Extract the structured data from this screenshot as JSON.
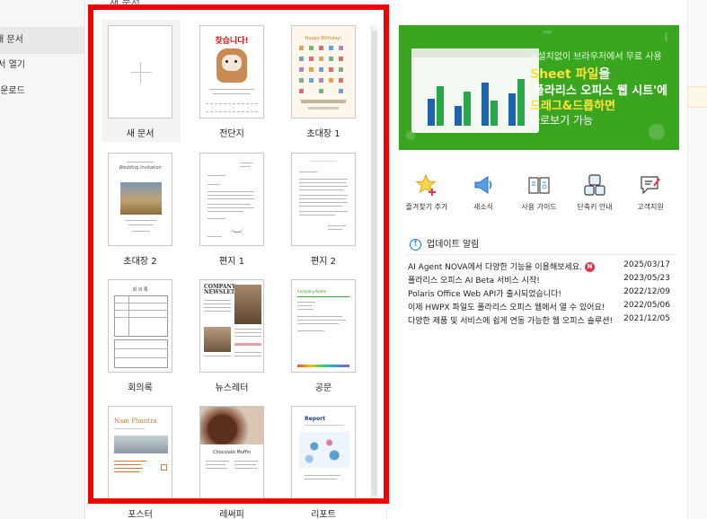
{
  "sidebar": {
    "items": [
      {
        "label": "새 문서",
        "active": true
      },
      {
        "label": "문서 열기",
        "active": false
      },
      {
        "label": "다운로드",
        "active": false
      }
    ]
  },
  "templates_section": {
    "title": "새 문서",
    "templates": [
      {
        "label": "새 문서"
      },
      {
        "label": "전단지",
        "thumb_text": "찾습니다!"
      },
      {
        "label": "초대장 1",
        "thumb_text": "Happy Birthday!"
      },
      {
        "label": "초대장 2",
        "thumb_text": "Wedding Invitation"
      },
      {
        "label": "편지 1"
      },
      {
        "label": "편지 2"
      },
      {
        "label": "회의록",
        "thumb_text": "회 의 록"
      },
      {
        "label": "뉴스레터",
        "thumb_text": "COMPANY NEWSLETTER"
      },
      {
        "label": "공문",
        "thumb_text": "Company Name"
      },
      {
        "label": "포스터",
        "thumb_text": "Nam Phuntra"
      },
      {
        "label": "레써피",
        "thumb_text": "Chocolate Muffin"
      },
      {
        "label": "리포트",
        "thumb_text": "Report"
      }
    ]
  },
  "banner": {
    "line1": "#설치없이 브라우저에서 무료 사용",
    "line2_highlight": "Sheet 파일",
    "line2_rest": "을",
    "line3": "'폴라리스 오피스 웹 시트'에",
    "line4": "드래그&드롭하면",
    "line5": "바로보기 가능",
    "bg_color": "#3aa51f",
    "accent_color": "#ffe23d"
  },
  "quick_links": [
    {
      "label": "즐겨찾기 추가",
      "icon": "star-add-icon"
    },
    {
      "label": "새소식",
      "icon": "megaphone-icon"
    },
    {
      "label": "사용 가이드",
      "icon": "book-icon"
    },
    {
      "label": "단축키 안내",
      "icon": "keyboard-icon"
    },
    {
      "label": "고객지원",
      "icon": "support-chat-icon"
    }
  ],
  "updates": {
    "title": "업데이트 알림",
    "items": [
      {
        "text": "AI Agent NOVA에서 다양한 기능을 이용해보세요.",
        "date": "2025/03/17",
        "badge": "N"
      },
      {
        "text": "폴라리스 오피스 AI Beta 서비스 시작!",
        "date": "2023/05/23"
      },
      {
        "text": "Polaris Office Web API가 출시되었습니다!",
        "date": "2022/12/09"
      },
      {
        "text": "이제 HWPX 파일도 폴라리스 오피스 웹에서 열 수 있어요!",
        "date": "2022/05/06"
      },
      {
        "text": "다양한 제품 및 서비스에 쉽게 연동 가능한 웹 오피스 솔루션!",
        "date": "2021/12/05"
      }
    ]
  },
  "highlight_color": "#f20000"
}
